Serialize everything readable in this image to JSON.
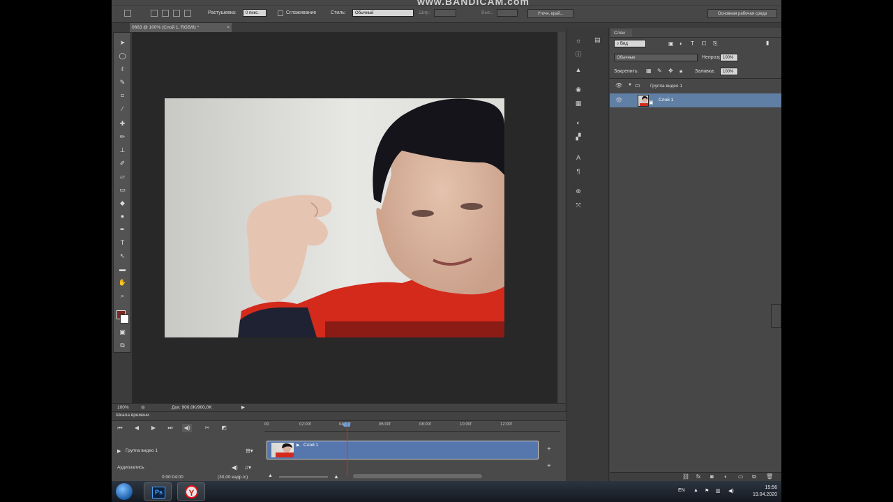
{
  "watermark": "www.BANDICAM.com",
  "options_bar": {
    "feather_label": "Растушевка:",
    "feather_value": "0 пикс.",
    "antialias_label": "Сглаживание",
    "style_label": "Стиль:",
    "style_value": "Обычный",
    "width_label": "Шир.:",
    "height_label": "Выс.:",
    "refine_edge": "Уточн. край...",
    "workspace": "Основная рабочая среда"
  },
  "document_tab": {
    "title": "0663 @ 100% (Слой 1, RGB/8) *",
    "close": "×"
  },
  "status_bar": {
    "zoom": "100%",
    "doc": "Док: 900,0K/900,0K"
  },
  "timeline": {
    "title": "Шкала времени",
    "ruler_ticks": [
      "00",
      "02:00f",
      "04:00f",
      "06:00f",
      "08:00f",
      "10:00f",
      "12:00f"
    ],
    "group_label": "Группа видео 1",
    "clip_label": "Слой 1",
    "audio_label": "Аудиозапись",
    "timecode": "0:00:04:00",
    "fps": "(30,00 кадр./с)"
  },
  "layers_panel": {
    "tab": "Слои",
    "filter_kind": "Вид",
    "blend_mode": "Обычные",
    "opacity_label": "Непрозр.:",
    "opacity_value": "100%",
    "lock_label": "Закрепить:",
    "fill_label": "Заливка:",
    "fill_value": "100%",
    "layers": [
      {
        "name": "Группа видео 1",
        "visible": true,
        "selected": false,
        "type": "group"
      },
      {
        "name": "Слой 1",
        "visible": true,
        "selected": true,
        "type": "video"
      }
    ]
  },
  "taskbar": {
    "apps": [
      "Ps",
      "Y"
    ],
    "lang": "EN",
    "time": "15:56",
    "date": "19.04.2020"
  },
  "colors": {
    "foreground_swatch": "#7a2a22",
    "background_swatch": "#ffffff",
    "selected_layer": "#5f7fa5",
    "clip": "#5677ad",
    "playhead": "#d63030"
  }
}
